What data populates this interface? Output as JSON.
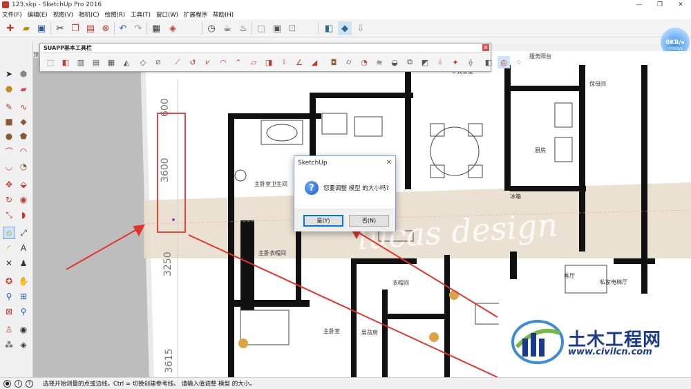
{
  "window": {
    "title": "123.skp - SketchUp Pro 2016",
    "controls": [
      "—",
      "❐",
      "✕"
    ]
  },
  "menu": [
    "文件(F)",
    "编辑(E)",
    "视图(V)",
    "相机(C)",
    "绘图(R)",
    "工具(T)",
    "窗口(W)",
    "扩展程序",
    "帮助(H)"
  ],
  "scene_tab": "顶",
  "suapp_toolbar": {
    "title": "SUAPP基本工具栏",
    "close": "×"
  },
  "floorplan": {
    "dimensions": [
      "600",
      "3600",
      "3250",
      "3615"
    ],
    "rooms": [
      "中式茶室",
      "服务阳台",
      "保母间",
      "厨房",
      "主卧室卫生间",
      "主卧衣帽间",
      "衣帽间",
      "男孩房",
      "主卧室",
      "客厅",
      "私家电梯厅",
      "冰箱"
    ],
    "watermark": "lucas design"
  },
  "dialog": {
    "title": "SketchUp",
    "close": "✕",
    "icon": "question-icon",
    "message": "您要调整 模型 的大小吗?",
    "yes": "是(Y)",
    "no": "否(N)"
  },
  "network": {
    "speed": "0KB/s",
    "upload": "+0KB/s"
  },
  "statusbar": {
    "text": "选择开始测量的点或边线。Ctrl = 切换创建参考线。 请输入值调整 模型 的大小。"
  },
  "logo": {
    "brand": "土木工程网",
    "url": "www.civilcn.com"
  },
  "colors": {
    "annotation_red": "#e3322b",
    "dialog_border": "#7a9ccf",
    "primary_button": "#0078d7",
    "logo_blue": "#1a3a8a"
  }
}
